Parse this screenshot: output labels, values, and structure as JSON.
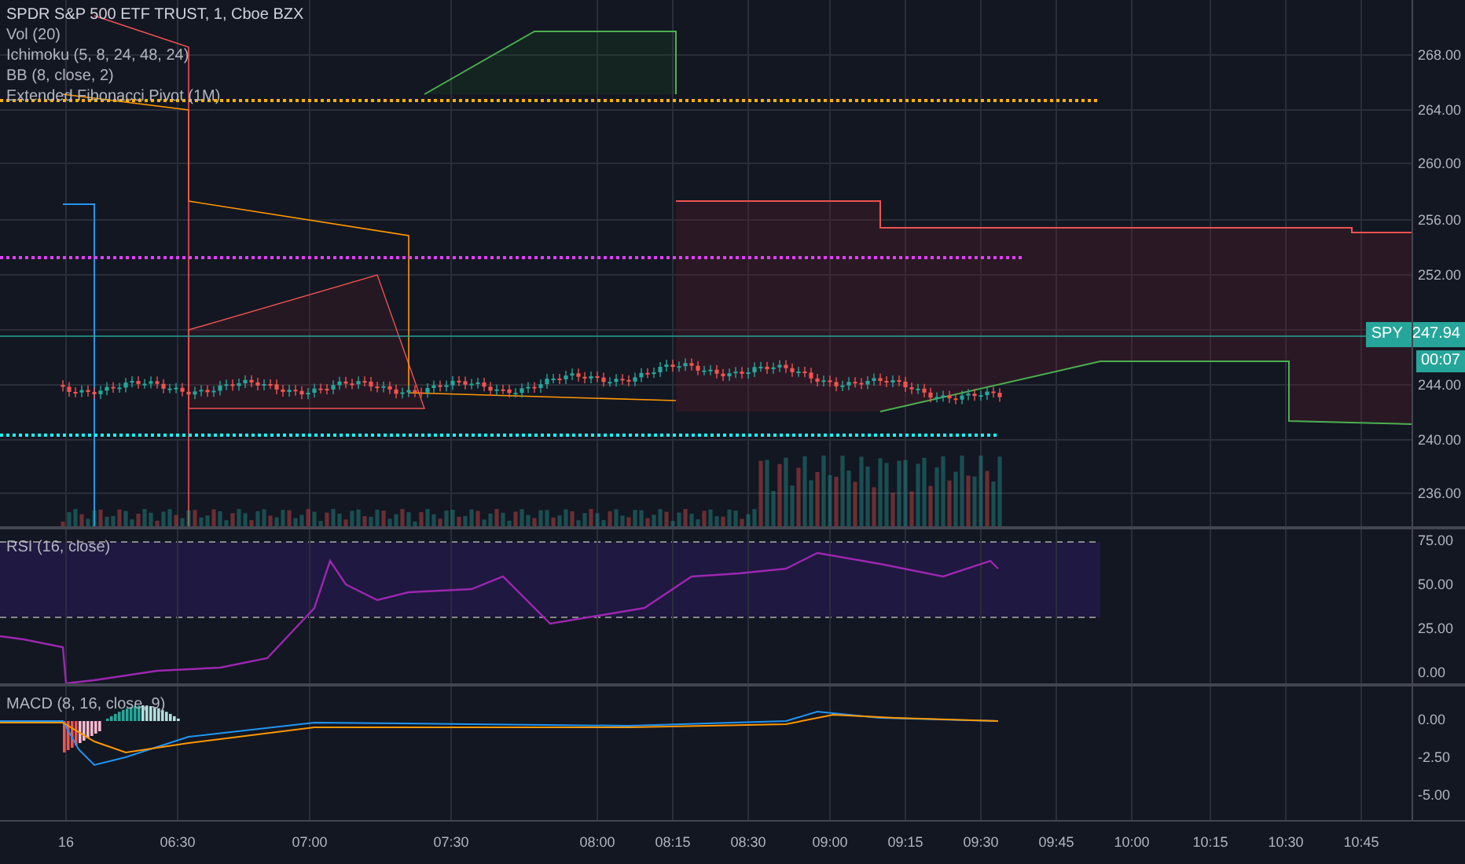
{
  "legend": {
    "title": "SPDR S&P 500 ETF TRUST, 1, Cboe BZX",
    "indicators": [
      "Vol (20)",
      "Ichimoku (5, 8, 24, 48, 24)",
      "BB (8, close, 2)",
      "Extended Fibonacci Pivot (1M)"
    ]
  },
  "price_axis": {
    "ticks": [
      "268.00",
      "264.00",
      "260.00",
      "256.00",
      "252.00",
      "244.00",
      "240.00",
      "236.00"
    ]
  },
  "price_tag": {
    "symbol": "SPY",
    "value": "247.94",
    "countdown": "00:07"
  },
  "rsi": {
    "label": "RSI (16, close)",
    "ticks": [
      "75.00",
      "50.00",
      "25.00",
      "0.00"
    ]
  },
  "macd": {
    "label": "MACD (8, 16, close, 9)",
    "ticks": [
      "0.00",
      "-2.50",
      "-5.00"
    ]
  },
  "time_axis": {
    "labels": [
      "16",
      "06:30",
      "07:00",
      "07:30",
      "08:00",
      "08:15",
      "08:30",
      "09:00",
      "09:15",
      "09:30",
      "09:45",
      "10:00",
      "10:15",
      "10:30",
      "10:45"
    ]
  }
}
